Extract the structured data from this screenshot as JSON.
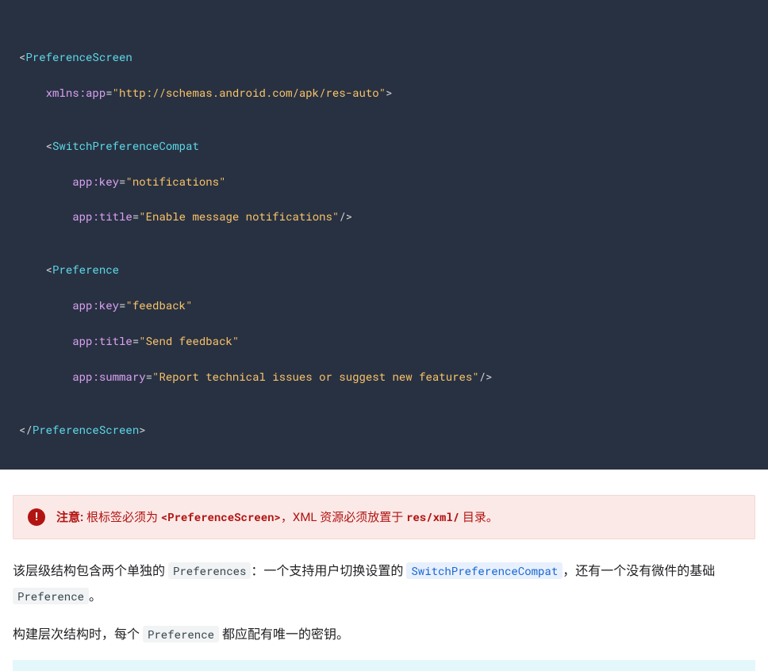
{
  "code": {
    "open_root": {
      "name": "PreferenceScreen"
    },
    "root_attr": {
      "attr": "xmlns:app",
      "val": "http://schemas.android.com/apk/res-auto"
    },
    "switch": {
      "name": "SwitchPreferenceCompat"
    },
    "switch_key": {
      "attr": "app:key",
      "val": "notifications"
    },
    "switch_title": {
      "attr": "app:title",
      "val": "Enable message notifications"
    },
    "pref": {
      "name": "Preference"
    },
    "pref_key": {
      "attr": "app:key",
      "val": "feedback"
    },
    "pref_title": {
      "attr": "app:title",
      "val": "Send feedback"
    },
    "pref_summary": {
      "attr": "app:summary",
      "val": "Report technical issues or suggest new features"
    },
    "close_root": {
      "name": "PreferenceScreen"
    }
  },
  "note": {
    "label": "注意:",
    "before1": " 根标签必须为 ",
    "code1": "<PreferenceScreen>",
    "middle": "，XML 资源必须放置于 ",
    "code2": "res/xml/",
    "after": " 目录。"
  },
  "para1": {
    "t1": "该层级结构包含两个单独的 ",
    "c1": "Preferences",
    "t2": "：一个支持用户切换设置的 ",
    "c2": "SwitchPreferenceCompat",
    "t3": "，还有一个没有微件的基础 ",
    "c3": "Preference",
    "t4": "。"
  },
  "para2": {
    "t1": "构建层次结构时，每个 ",
    "c1": "Preference",
    "t2": " 都应配有唯一的密钥。"
  }
}
